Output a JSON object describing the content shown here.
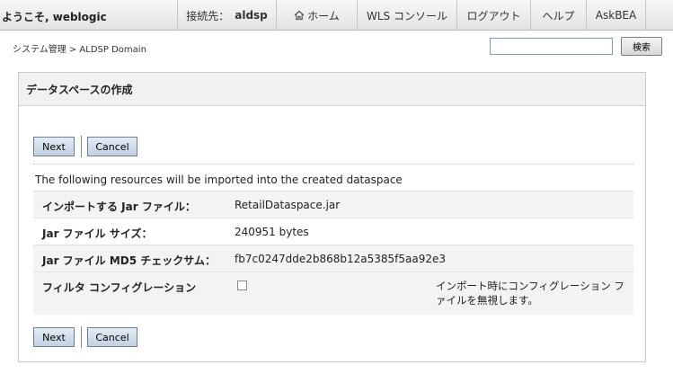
{
  "header": {
    "welcome": "ようこそ, weblogic",
    "connection_label": "接続先：",
    "connection_server": "aldsp",
    "nav": [
      {
        "label": "ホーム",
        "icon": "home-icon"
      },
      {
        "label": "WLS コンソール"
      },
      {
        "label": "ログアウト"
      },
      {
        "label": "ヘルプ"
      },
      {
        "label": "AskBEA"
      }
    ]
  },
  "breadcrumb": "システム管理 > ALDSP Domain",
  "search": {
    "value": "",
    "button_label": "検索"
  },
  "panel": {
    "title": "データスペースの作成",
    "next_label": "Next",
    "cancel_label": "Cancel",
    "intro": "The following resources will be imported into the created dataspace",
    "rows": [
      {
        "label": "インポートする Jar ファイル：",
        "value": "RetailDataspace.jar"
      },
      {
        "label": "Jar ファイル サイズ：",
        "value": "240951 bytes"
      },
      {
        "label": "Jar ファイル MD5 チェックサム：",
        "value": "fb7c0247dde2b868b12a5385f5aa92e3"
      },
      {
        "label": "フィルタ コンフィグレーション",
        "checked": false,
        "hint": "インポート時にコンフィグレーション ファイルを無視します。"
      }
    ]
  },
  "colors": {
    "button_border": "#6b7f95",
    "button_fill": "#c2d0e0",
    "row_alt": "#f3f3f3"
  }
}
